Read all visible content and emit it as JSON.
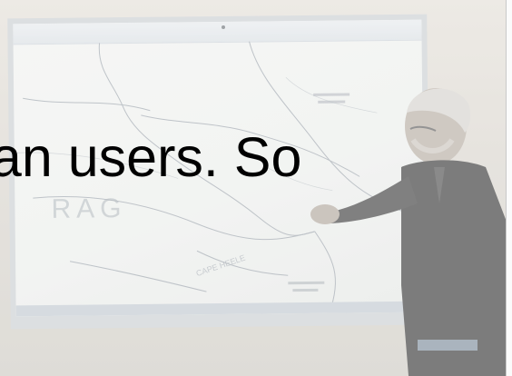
{
  "slide": {
    "caption": "ean users. So",
    "background_image": "photo of a presenter pointing at a map projected on a whiteboard",
    "accent_colors": {
      "caption_text": "#000000",
      "board": "#f0f1ef",
      "wall": "#ddd9d2",
      "presenter_jacket": "#4a4a4a"
    }
  },
  "icons": [
    "presenter-figure",
    "map-projection"
  ]
}
